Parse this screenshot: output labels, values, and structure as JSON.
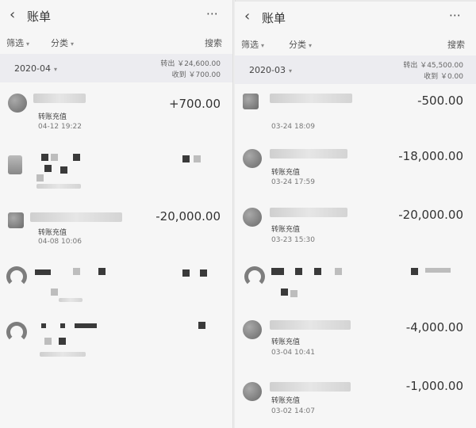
{
  "left": {
    "title": "账单",
    "filter_label": "筛选",
    "category_label": "分类",
    "search_label": "搜索",
    "month": "2020-04",
    "spend_summary": "转出 ￥24,600.00",
    "income_summary": "收到 ￥700.00",
    "transactions": [
      {
        "desc": "转账充值",
        "time": "04-12 19:22",
        "amount": "+700.00"
      },
      {
        "desc": "",
        "time": "",
        "amount": ""
      },
      {
        "desc": "转账充值",
        "time": "04-08 10:06",
        "amount": "-20,000.00"
      },
      {
        "desc": "",
        "time": "",
        "amount": ""
      },
      {
        "desc": "",
        "time": "",
        "amount": ""
      }
    ]
  },
  "right": {
    "title": "账单",
    "filter_label": "筛选",
    "category_label": "分类",
    "search_label": "搜索",
    "month": "2020-03",
    "spend_summary": "转出 ￥45,500.00",
    "income_summary": "收到 ￥0.00",
    "transactions": [
      {
        "desc": "",
        "time": "03-24 18:09",
        "amount": "-500.00"
      },
      {
        "desc": "转账充值",
        "time": "03-24 17:59",
        "amount": "-18,000.00"
      },
      {
        "desc": "转账充值",
        "time": "03-23 15:30",
        "amount": "-20,000.00"
      },
      {
        "desc": "",
        "time": "",
        "amount": ""
      },
      {
        "desc": "转账充值",
        "time": "03-04 10:41",
        "amount": "-4,000.00"
      },
      {
        "desc": "转账充值",
        "time": "03-02 14:07",
        "amount": "-1,000.00"
      }
    ]
  },
  "icons": {
    "back": "back-arrow-icon",
    "more": "more-icon",
    "caret": "caret-down-icon"
  }
}
